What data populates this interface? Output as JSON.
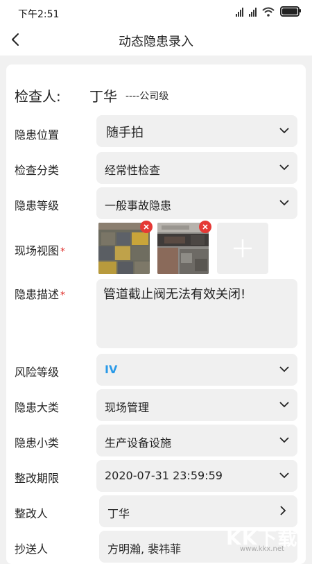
{
  "status_bar": {
    "time": "下午2:51"
  },
  "nav": {
    "title": "动态隐患录入"
  },
  "inspector": {
    "label": "检查人:",
    "name": "丁华",
    "level": "----公司级"
  },
  "fields": {
    "location": {
      "label": "隐患位置",
      "value": "随手拍"
    },
    "category": {
      "label": "检查分类",
      "value": "经常性检查"
    },
    "grade": {
      "label": "隐患等级",
      "value": "一般事故隐患"
    },
    "photos": {
      "label": "现场视图"
    },
    "description": {
      "label": "隐患描述",
      "value": "管道截止阀无法有效关闭!"
    },
    "risk": {
      "label": "风险等级",
      "value": "IV"
    },
    "major_type": {
      "label": "隐患大类",
      "value": "现场管理"
    },
    "minor_type": {
      "label": "隐患小类",
      "value": "生产设备设施"
    },
    "deadline": {
      "label": "整改期限",
      "value": "2020-07-31 23:59:59"
    },
    "rectifier": {
      "label": "整改人",
      "value": "丁华"
    },
    "cc": {
      "label": "抄送人",
      "value": "方明瀚, 裴祎菲"
    }
  },
  "required_mark": "*",
  "watermark": {
    "text": "KK下载",
    "url": "www.kkx.net"
  },
  "colors": {
    "accent_blue": "#2a9ae8",
    "required_red": "#e0322e",
    "delete_red": "#e53935"
  }
}
